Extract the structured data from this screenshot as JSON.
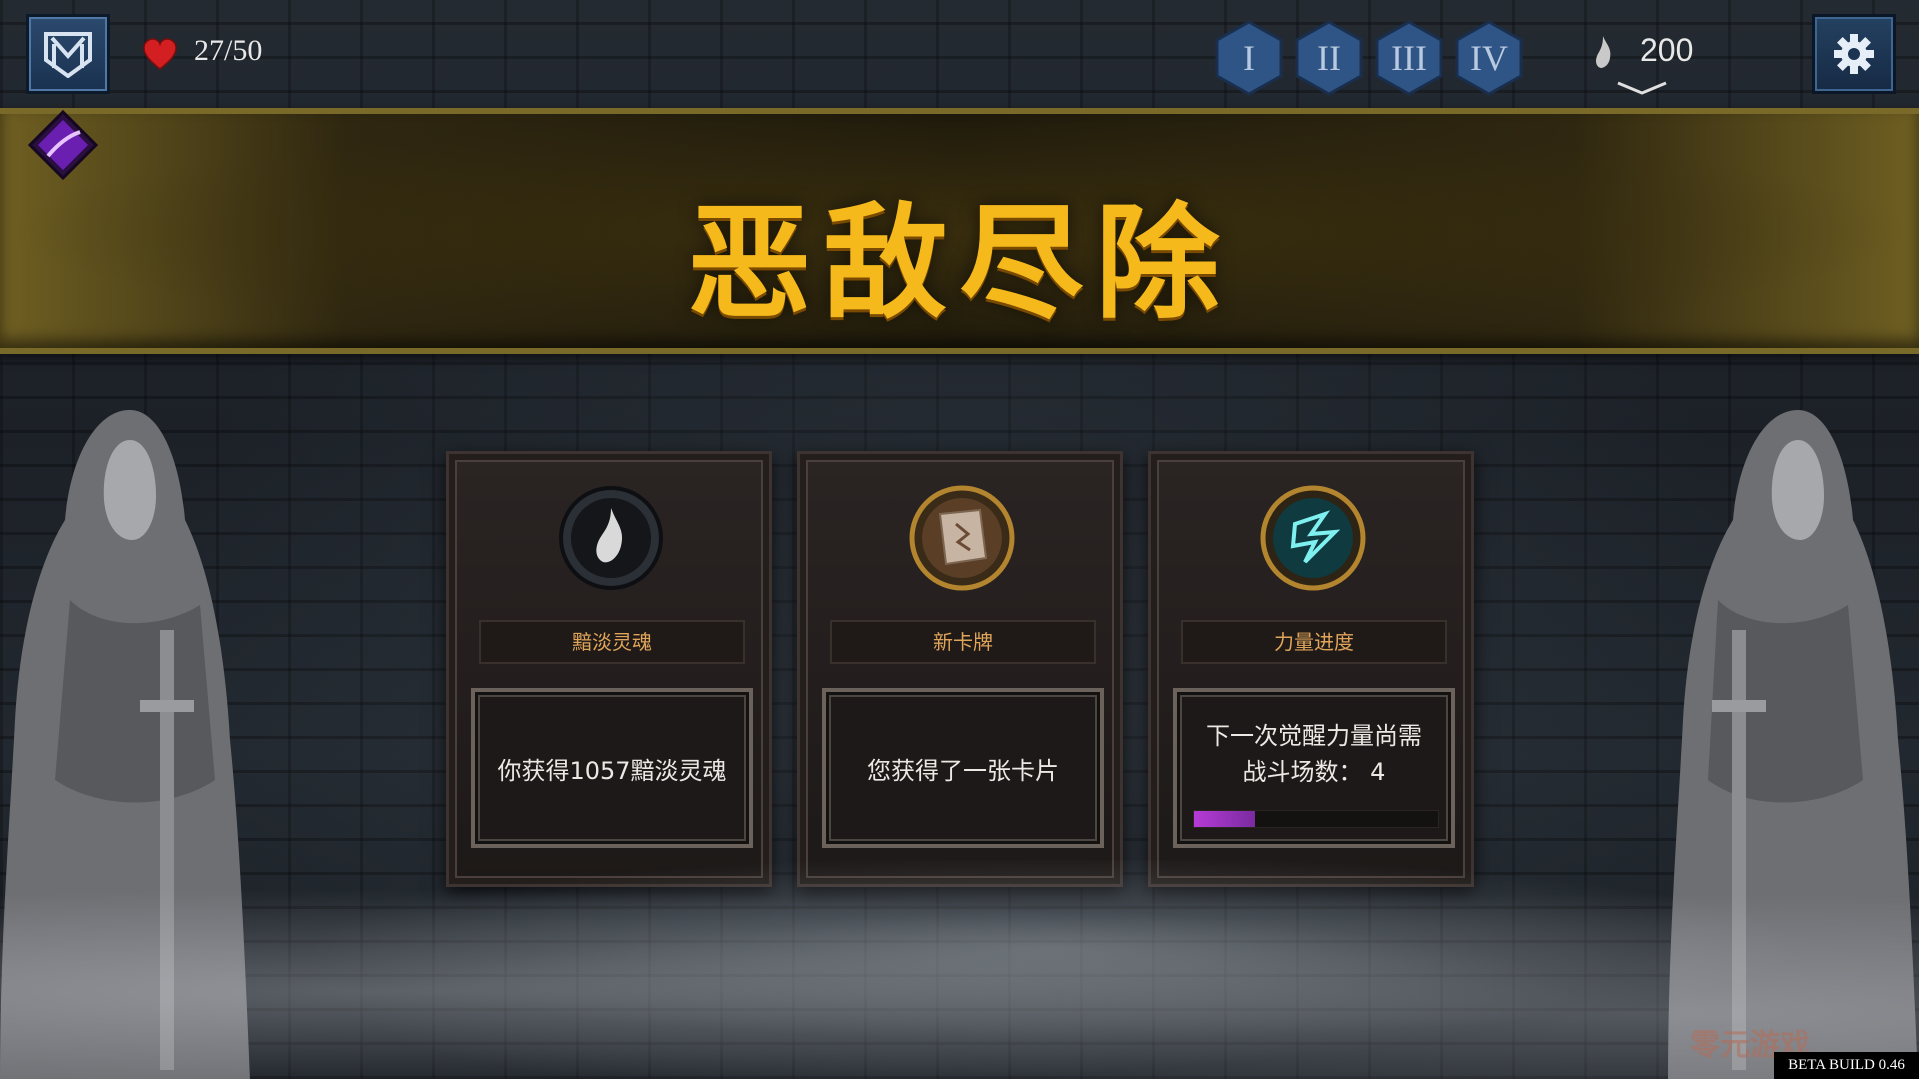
{
  "hud": {
    "health": "27/50",
    "souls": "200",
    "acts": [
      "I",
      "II",
      "III",
      "IV"
    ]
  },
  "banner": {
    "title": "恶敌尽除"
  },
  "rewards": [
    {
      "title": "黯淡灵魂",
      "text": "你获得1057黯淡灵魂",
      "icon": "soul-orb-icon"
    },
    {
      "title": "新卡牌",
      "text": "您获得了一张卡片",
      "icon": "card-scroll-icon"
    },
    {
      "title": "力量进度",
      "line1": "下一次觉醒力量尚需",
      "line2": "战斗场数： 4",
      "progress": 0.25,
      "icon": "rune-emblem-icon"
    }
  ],
  "watermark": "零元游戏",
  "build": "BETA BUILD 0.46",
  "colors": {
    "banner_text": "#f5b91c",
    "card_title": "#e0a55a",
    "progress": "#b63bd6",
    "act_hex": "#2f5586"
  }
}
